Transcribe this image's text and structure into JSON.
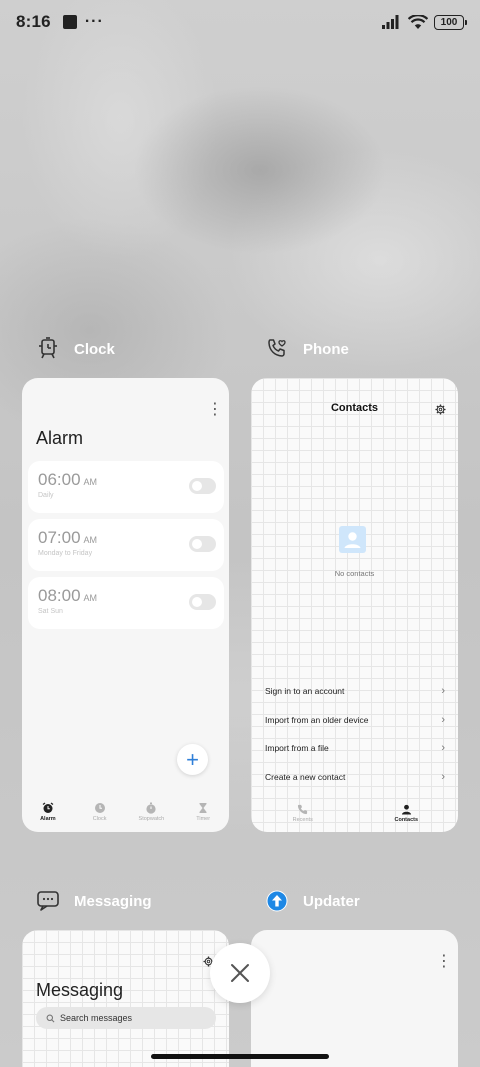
{
  "status_bar": {
    "time": "8:16",
    "more": "···",
    "battery": "100"
  },
  "recents": {
    "apps": [
      {
        "name": "Clock",
        "icon": "alarm-clock-icon"
      },
      {
        "name": "Phone",
        "icon": "phone-icon"
      },
      {
        "name": "Messaging",
        "icon": "message-bubble-icon"
      },
      {
        "name": "Updater",
        "icon": "upload-arrow-icon"
      }
    ]
  },
  "clock": {
    "title": "Alarm",
    "alarms": [
      {
        "time": "06:00",
        "ampm": "AM",
        "repeat": "Daily",
        "enabled": false
      },
      {
        "time": "07:00",
        "ampm": "AM",
        "repeat": "Monday to Friday",
        "enabled": false
      },
      {
        "time": "08:00",
        "ampm": "AM",
        "repeat": "Sat Sun",
        "enabled": false
      }
    ],
    "add": "+",
    "nav": [
      "Alarm",
      "Clock",
      "Stopwatch",
      "Timer"
    ]
  },
  "phone": {
    "title": "Contacts",
    "empty": "No contacts",
    "menu": [
      "Sign in to an account",
      "Import from an older device",
      "Import from a file",
      "Create a new contact"
    ],
    "nav": [
      "Recents",
      "Contacts"
    ]
  },
  "messaging": {
    "title": "Messaging",
    "search_placeholder": "Search messages"
  },
  "colors": {
    "accent": "#2f7fd8",
    "updater": "#1e88e5"
  }
}
